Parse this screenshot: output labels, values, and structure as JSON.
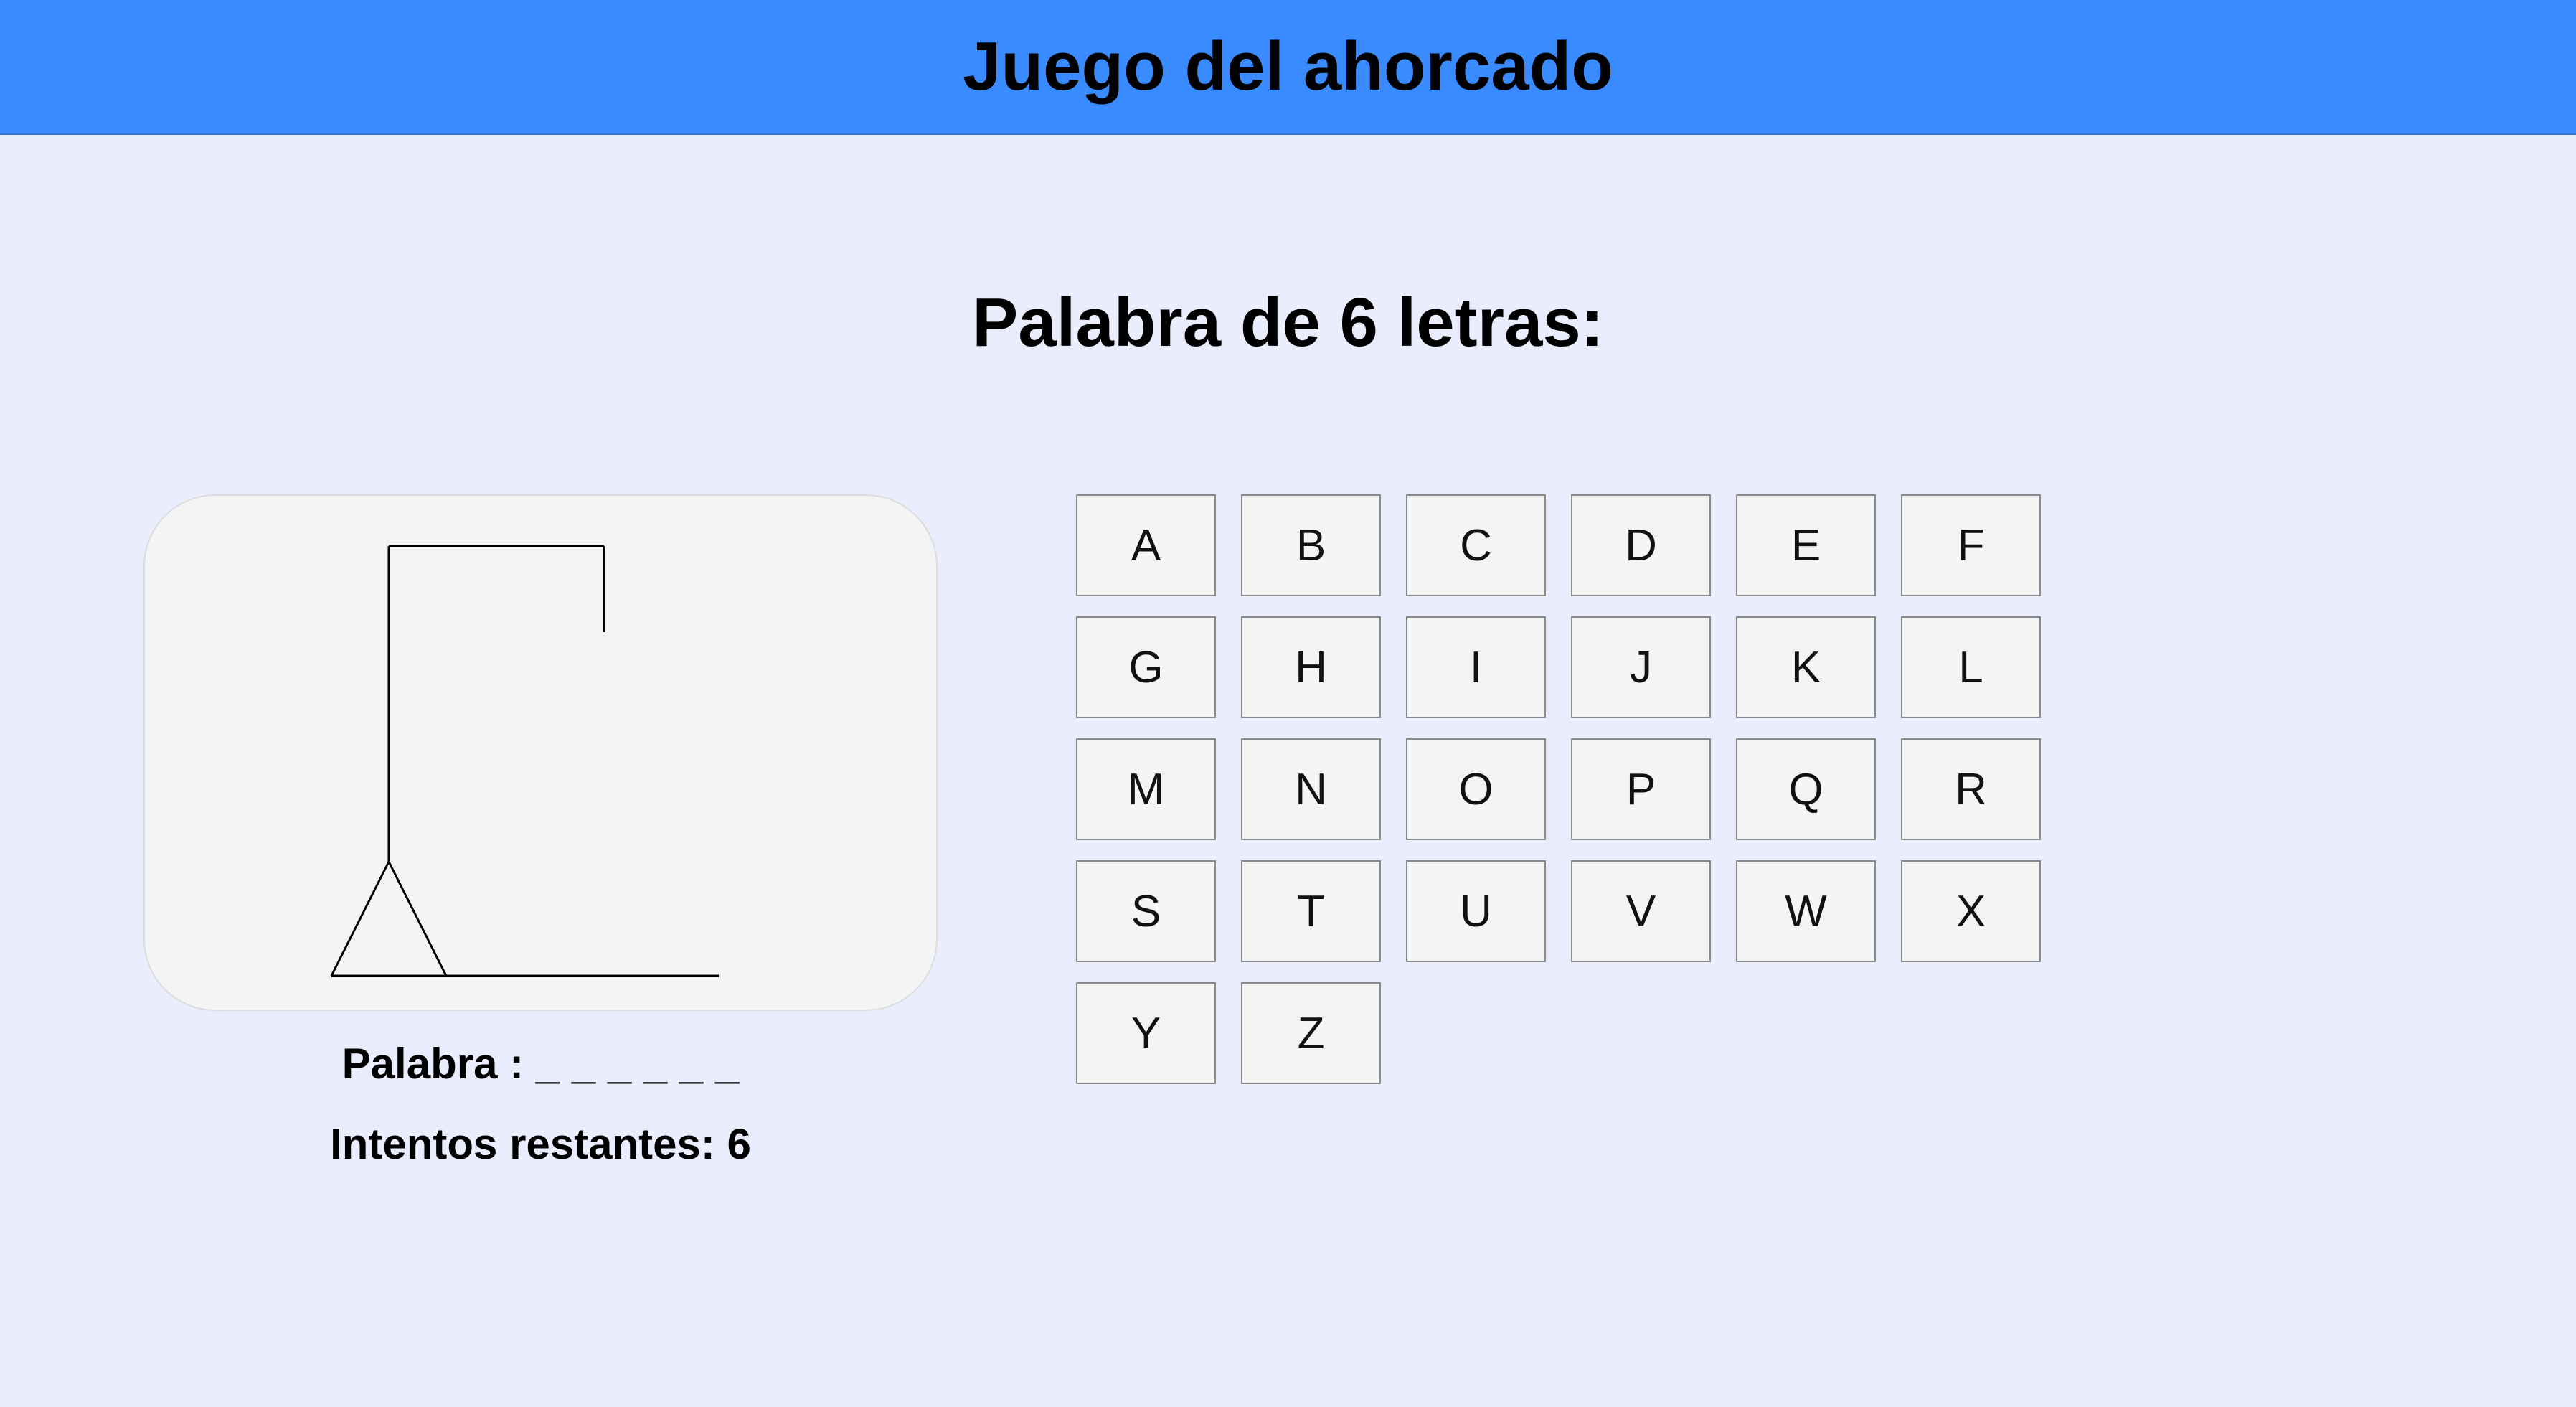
{
  "header": {
    "title": "Juego del ahorcado",
    "color": "#3a8bff"
  },
  "subtitle": "Palabra de 6 letras:",
  "status": {
    "word_label": "Palabra : _ _ _ _ _ _",
    "tries_label": "Intentos restantes: 6"
  },
  "gallows": {
    "stage": "empty gallows, no body parts",
    "line_color": "#000000"
  },
  "keyboard": {
    "letters": [
      "A",
      "B",
      "C",
      "D",
      "E",
      "F",
      "G",
      "H",
      "I",
      "J",
      "K",
      "L",
      "M",
      "N",
      "O",
      "P",
      "Q",
      "R",
      "S",
      "T",
      "U",
      "V",
      "W",
      "X",
      "Y",
      "Z"
    ]
  },
  "colors": {
    "page_background": "#e9edfd",
    "panel_background": "#f4f4f4",
    "key_border": "#8a8a8a"
  }
}
